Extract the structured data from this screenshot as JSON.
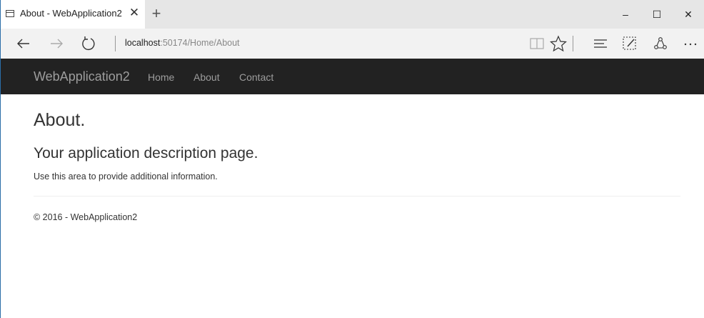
{
  "browser": {
    "tab_title": "About - WebApplication2",
    "tab_close": "✕",
    "new_tab": "+",
    "window_controls": {
      "minimize": "–",
      "maximize": "☐",
      "close": "✕"
    },
    "address": {
      "host": "localhost",
      "path": ":50174/Home/About"
    },
    "icons": [
      "back-icon",
      "forward-icon",
      "refresh-icon",
      "reading-view-icon",
      "favorite-star-icon",
      "hub-icon",
      "web-note-icon",
      "share-icon",
      "more-icon"
    ]
  },
  "site": {
    "brand": "WebApplication2",
    "nav": [
      "Home",
      "About",
      "Contact"
    ]
  },
  "page": {
    "title": "About.",
    "subtitle": "Your application description page.",
    "description": "Use this area to provide additional information.",
    "footer": "© 2016 - WebApplication2"
  }
}
